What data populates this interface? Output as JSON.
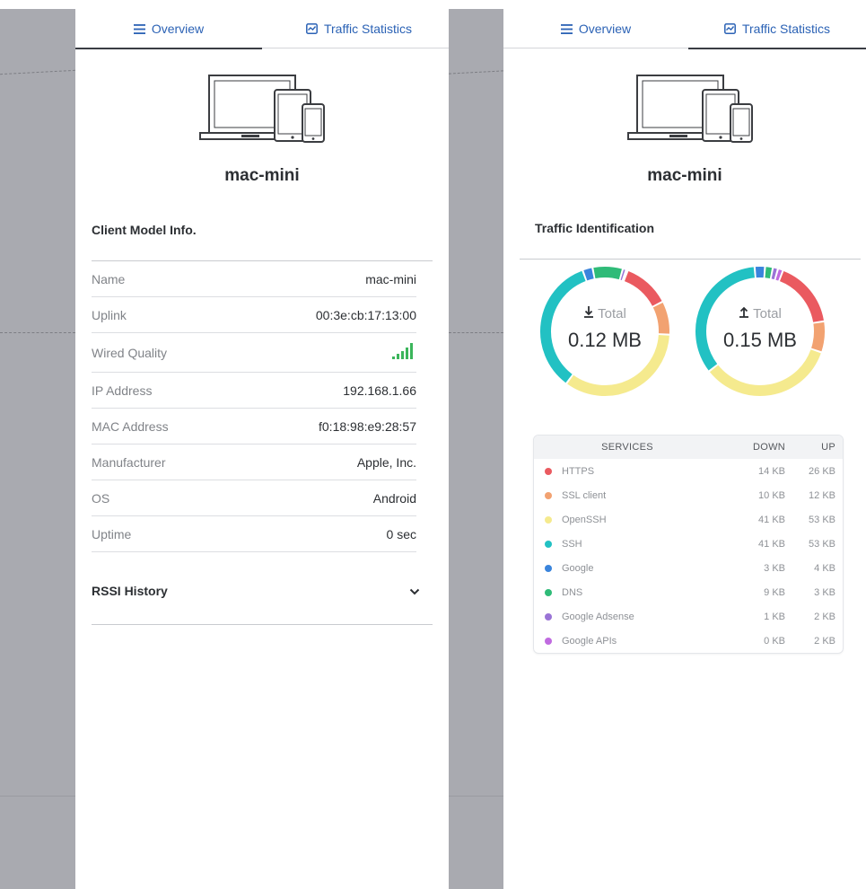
{
  "colors": {
    "accent": "#2b62b5",
    "signal": "#3bb55b",
    "https": "#ea5a60",
    "ssl_client": "#f2a271",
    "openssh": "#f5ea8e",
    "ssh": "#22c1c3",
    "google": "#3a84dc",
    "dns": "#2fbb78",
    "google_adsense": "#9a74d6",
    "google_apis": "#c06be0"
  },
  "left_panel": {
    "tabs": [
      {
        "label": "Overview",
        "icon": "list-icon",
        "active": true
      },
      {
        "label": "Traffic Statistics",
        "icon": "chart-box-icon",
        "active": false
      }
    ],
    "device_name": "mac-mini",
    "section_title": "Client Model Info.",
    "info_rows": [
      {
        "key": "Name",
        "value": "mac-mini"
      },
      {
        "key": "Uplink",
        "value": "00:3e:cb:17:13:00"
      },
      {
        "key": "Wired Quality",
        "value": "",
        "icon": "signal-bars-icon"
      },
      {
        "key": "IP Address",
        "value": "192.168.1.66"
      },
      {
        "key": "MAC Address",
        "value": "f0:18:98:e9:28:57"
      },
      {
        "key": "Manufacturer",
        "value": "Apple, Inc."
      },
      {
        "key": "OS",
        "value": "Android"
      },
      {
        "key": "Uptime",
        "value": "0 sec"
      }
    ],
    "rssi_title": "RSSI History"
  },
  "right_panel": {
    "tabs": [
      {
        "label": "Overview",
        "icon": "list-icon",
        "active": false
      },
      {
        "label": "Traffic Statistics",
        "icon": "chart-box-icon",
        "active": true
      }
    ],
    "device_name": "mac-mini",
    "section_title": "Traffic Identification",
    "download": {
      "label": "Total",
      "value": "0.12 MB",
      "icon": "download-icon"
    },
    "upload": {
      "label": "Total",
      "value": "0.15 MB",
      "icon": "upload-icon"
    },
    "services_table": {
      "headers": [
        "SERVICES",
        "DOWN",
        "UP"
      ],
      "rows": [
        {
          "service": "HTTPS",
          "down": "14 KB",
          "up": "26 KB",
          "color": "#ea5a60"
        },
        {
          "service": "SSL client",
          "down": "10 KB",
          "up": "12 KB",
          "color": "#f2a271"
        },
        {
          "service": "OpenSSH",
          "down": "41 KB",
          "up": "53 KB",
          "color": "#f5ea8e"
        },
        {
          "service": "SSH",
          "down": "41 KB",
          "up": "53 KB",
          "color": "#22c1c3"
        },
        {
          "service": "Google",
          "down": "3 KB",
          "up": "4 KB",
          "color": "#3a84dc"
        },
        {
          "service": "DNS",
          "down": "9 KB",
          "up": "3 KB",
          "color": "#2fbb78"
        },
        {
          "service": "Google Adsense",
          "down": "1 KB",
          "up": "2 KB",
          "color": "#9a74d6"
        },
        {
          "service": "Google APIs",
          "down": "0 KB",
          "up": "2 KB",
          "color": "#c06be0"
        }
      ]
    }
  },
  "chart_data": [
    {
      "type": "pie",
      "title": "",
      "series": [
        {
          "categories": [
            "HTTPS",
            "SSL client",
            "OpenSSH",
            "SSH",
            "Google",
            "DNS",
            "Google Adsense",
            "Google APIs"
          ],
          "values": [
            14,
            10,
            41,
            41,
            3,
            9,
            1,
            0.5
          ]
        }
      ],
      "colors": [
        "#ea5a60",
        "#f2a271",
        "#f5ea8e",
        "#22c1c3",
        "#3a84dc",
        "#2fbb78",
        "#9a74d6",
        "#c06be0"
      ],
      "donut": true
    },
    {
      "type": "pie",
      "title": "",
      "series": [
        {
          "categories": [
            "HTTPS",
            "SSL client",
            "OpenSSH",
            "SSH",
            "Google",
            "DNS",
            "Google Adsense",
            "Google APIs"
          ],
          "values": [
            26,
            12,
            53,
            53,
            4,
            3,
            2,
            2
          ]
        }
      ],
      "colors": [
        "#ea5a60",
        "#f2a271",
        "#f5ea8e",
        "#22c1c3",
        "#3a84dc",
        "#2fbb78",
        "#9a74d6",
        "#c06be0"
      ],
      "donut": true
    }
  ]
}
